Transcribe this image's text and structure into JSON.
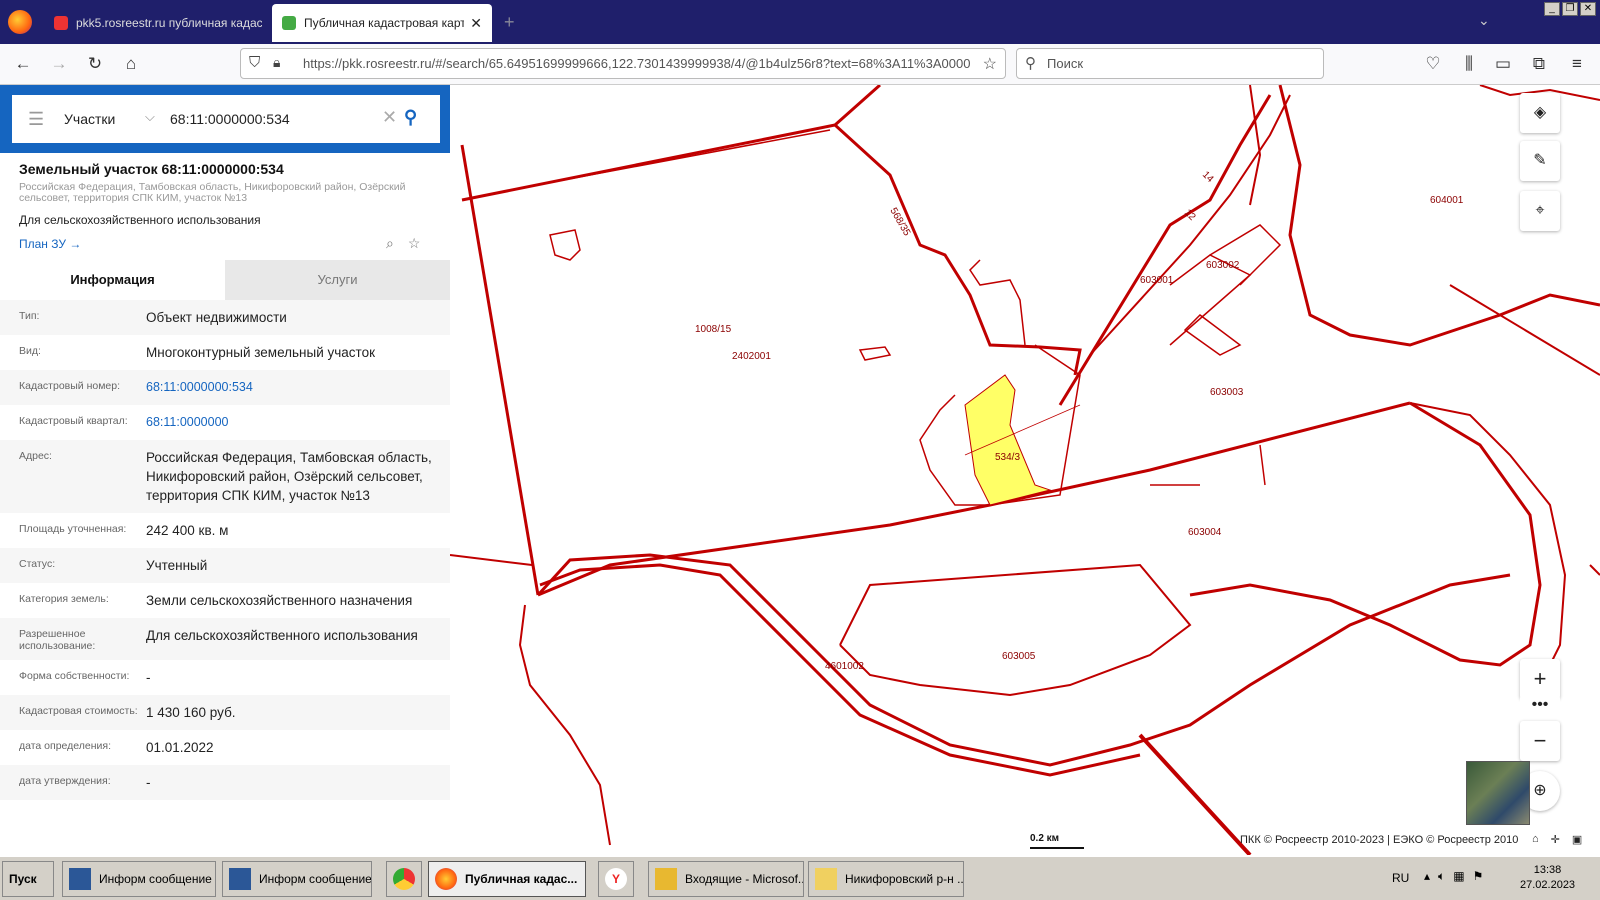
{
  "browser": {
    "tabs": [
      {
        "label": "pkk5.rosreestr.ru публичная кадас"
      },
      {
        "label": "Публичная кадастровая карта"
      }
    ],
    "url": "https://pkk.rosreestr.ru/#/search/65.64951699999666,122.7301439999938/4/@1b4ulz56r8?text=68%3A11%3A0000",
    "search_placeholder": "Поиск"
  },
  "search": {
    "type": "Участки",
    "value": "68:11:0000000:534"
  },
  "object": {
    "title": "Земельный участок 68:11:0000000:534",
    "address_short": "Российская Федерация, Тамбовская область, Никифоровский район, Озёрский сельсовет, территория СПК КИМ, участок №13",
    "use": "Для сельскохозяйственного использования",
    "plan_link": "План ЗУ →"
  },
  "tabs": {
    "info": "Информация",
    "services": "Услуги"
  },
  "rows": [
    {
      "label": "Тип:",
      "value": "Объект недвижимости"
    },
    {
      "label": "Вид:",
      "value": "Многоконтурный земельный участок"
    },
    {
      "label": "Кадастровый номер:",
      "value": "68:11:0000000:534"
    },
    {
      "label": "Кадастровый квартал:",
      "value": "68:11:0000000"
    },
    {
      "label": "Адрес:",
      "value": "Российская Федерация, Тамбовская область, Никифоровский район, Озёрский сельсовет, территория СПК КИМ, участок №13"
    },
    {
      "label": "Площадь уточненная:",
      "value": "242 400 кв. м"
    },
    {
      "label": "Статус:",
      "value": "Учтенный"
    },
    {
      "label": "Категория земель:",
      "value": "Земли сельскохозяйственного назначения"
    },
    {
      "label": "Разрешенное использование:",
      "value": "Для сельскохозяйственного использования"
    },
    {
      "label": "Форма собственности:",
      "value": "-"
    },
    {
      "label": "Кадастровая стоимость:",
      "value": "1 430 160 руб."
    },
    {
      "label": "дата определения:",
      "value": "01.01.2022"
    },
    {
      "label": "дата утверждения:",
      "value": "-"
    }
  ],
  "map": {
    "labels": [
      "1008/15",
      "2402001",
      "568/35",
      "14",
      "12",
      "603001",
      "603002",
      "604001",
      "603003",
      "534/3",
      "603004",
      "603005",
      "4601002"
    ],
    "scale": "0.2 км",
    "copyright": "ПКК © Росреестр 2010-2023 | ЕЭКО © Росреестр 2010"
  },
  "taskbar": {
    "start": "Пуск",
    "items": [
      "Информ сообщение ...",
      "Информ сообщение ...",
      "Публичная кадас...",
      "Входящие - Microsof...",
      "Никифоровский р-н ..."
    ],
    "lang": "RU",
    "time": "13:38",
    "date": "27.02.2023"
  },
  "colors": {
    "accent": "#1565c0",
    "parcel_line": "#c00000",
    "highlight": "#ffff66"
  }
}
